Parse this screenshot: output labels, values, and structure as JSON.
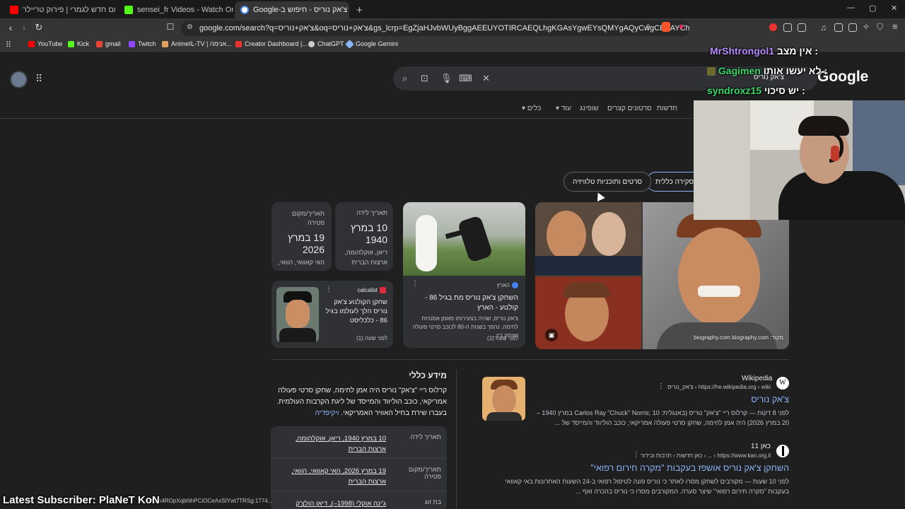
{
  "browser": {
    "tabs": [
      {
        "title": "ספיידרמן יום חדש לגמרי | פירוק טריילר",
        "active": false,
        "favicon_color": "#ff0000"
      },
      {
        "title": "sensei_fr Videos - Watch On-Demand",
        "active": false,
        "favicon_color": "#53fc18"
      },
      {
        "title": "צ'אק נוריס - חיפוש ב-Google",
        "active": true,
        "favicon_color": "#4285f4"
      }
    ],
    "new_tab": "+",
    "url": "google.com/search?q=צ'אק+נוריס&oq=צ'אק+נוריס&gs_lcrp=EgZjaHJvbWUyBggAEEUYOTIRCAEQLhgKGAsYgwEYsQMYgAQyCwgCEAAYChgLGIAEMgs...",
    "bookmarks": [
      "YouTube",
      "Kick",
      "gmail",
      "Twitch",
      "AnimeIL-TV | אנימה...",
      "Creator Dashboard |...",
      "ChatGPT",
      "Google Gemini"
    ],
    "window_controls": {
      "minimize": "—",
      "maximize": "▢",
      "close": "✕"
    }
  },
  "google": {
    "logo": "Google",
    "query": "צ'אק נוריס",
    "nav_tabs": [
      "כלים",
      "עוד",
      "שופינג",
      "סרטונים קצרים",
      "חדשות"
    ],
    "chips": [
      "סקירה כללית",
      "סרטים ותוכניות טלוויזיה"
    ],
    "knowledge_cards": {
      "birth": {
        "label": "תאריך לידה",
        "value": "10 במרץ 1940",
        "place": "ריאן, אוקלהומה, ארצות הברית"
      },
      "death": {
        "label": "תאריך/מקום פטירה",
        "value": "19 במרץ 2026",
        "place": "האי קאוואי, הוואי,"
      },
      "news1": {
        "source": "הארץ",
        "headline": "השחקן צ'אק נוריס מת בגיל 86 - קולנוע - הארץ",
        "snippet": "צ'אק נוריס, שהיה בצעירותו מאמן אמנויות לחימה, נהפך בשנות ה-80 לכוכב סרטי פעולה ושיחק בין...",
        "time": "לפני שעה (1)"
      },
      "news2": {
        "source": "calcalist",
        "headline": "שחקן הקולנוע צ'אק נוריס הלך לעולמו בגיל 86 - כלכליסט",
        "time": "לפני שעה (1)"
      },
      "image_source": "מקור: biography.com biography.com"
    },
    "info": {
      "title": "מידע כללי",
      "text": "קרלוס ריי \"צ'אק\" נוריס היה אמן לחימה, שחקן סרטי פעולה אמריקאי, כוכב הוליווד והמייסד של ליגת הקרבות העולמית. בעברו שירת בחיל האוויר האמריקאי.",
      "wiki_link": "ויקיפדיה",
      "facts": [
        {
          "key": "תאריך לידה",
          "value": "10 במרץ 1940, ריאן, אוקלהומה, ארצות הברית"
        },
        {
          "key": "תאריך/מקום פטירה",
          "value": "19 במרץ 2026, האי קאוואי, הוואי, ארצות הברית"
        },
        {
          "key": "בת זוג",
          "value": "ג'ינה אוקלי (1998–), דיאן הולצ'ק"
        }
      ]
    },
    "results": [
      {
        "site": "Wikipedia",
        "url": "https://he.wikipedia.org › wiki › צ'אק_נוריס",
        "title": "צ'אק נוריס",
        "snippet": "לפני 8 דקות — קרלוס ריי \"צ'אק\" נוריס (באנגלית: Carlos Ray \"Chuck\" Norris; 10 במרץ 1940 – 20 במרץ 2026) היה אמן לחימה, שחקן סרטי פעולה אמריקאי, כוכב הוליווד והמייסד של ..."
      },
      {
        "site": "כאן 11",
        "url": "https://www.kan.org.il › ... › כאן חדשות › תרבות ובידור",
        "title": "השחקן צ'אק נוריס אושפז בעקבות \"מקרה חירום רפואי\"",
        "snippet": "לפני 10 שעות — מקורבים לשחקן מסרו לאתר כי נוריס פונה לטיפול רפואי ב-24 השעות האחרונות באי קאוואי בעקבות \"מקרה חירום רפואי\" שיצר סערה. המקורבים מסרו כי נוריס בהכרה ואף ..."
      }
    ]
  },
  "stream": {
    "chat": [
      {
        "user": "MrShtrongol1",
        "message": "אין מצב :",
        "color": "#b48cff"
      },
      {
        "user": "Gagimen",
        "message": "לא יעשו אותו :",
        "color": "#3ad86a"
      },
      {
        "user": "syndroxz15",
        "message": "יש סיכוי :",
        "color": "#3ad86a"
      }
    ],
    "latest_subscriber": "Latest Subscriber: PlaNeT KoN",
    "status_url": "...NbL-n4ROpXqbhlhPCiOCeAxSIYwt7TRSg:1774..."
  }
}
